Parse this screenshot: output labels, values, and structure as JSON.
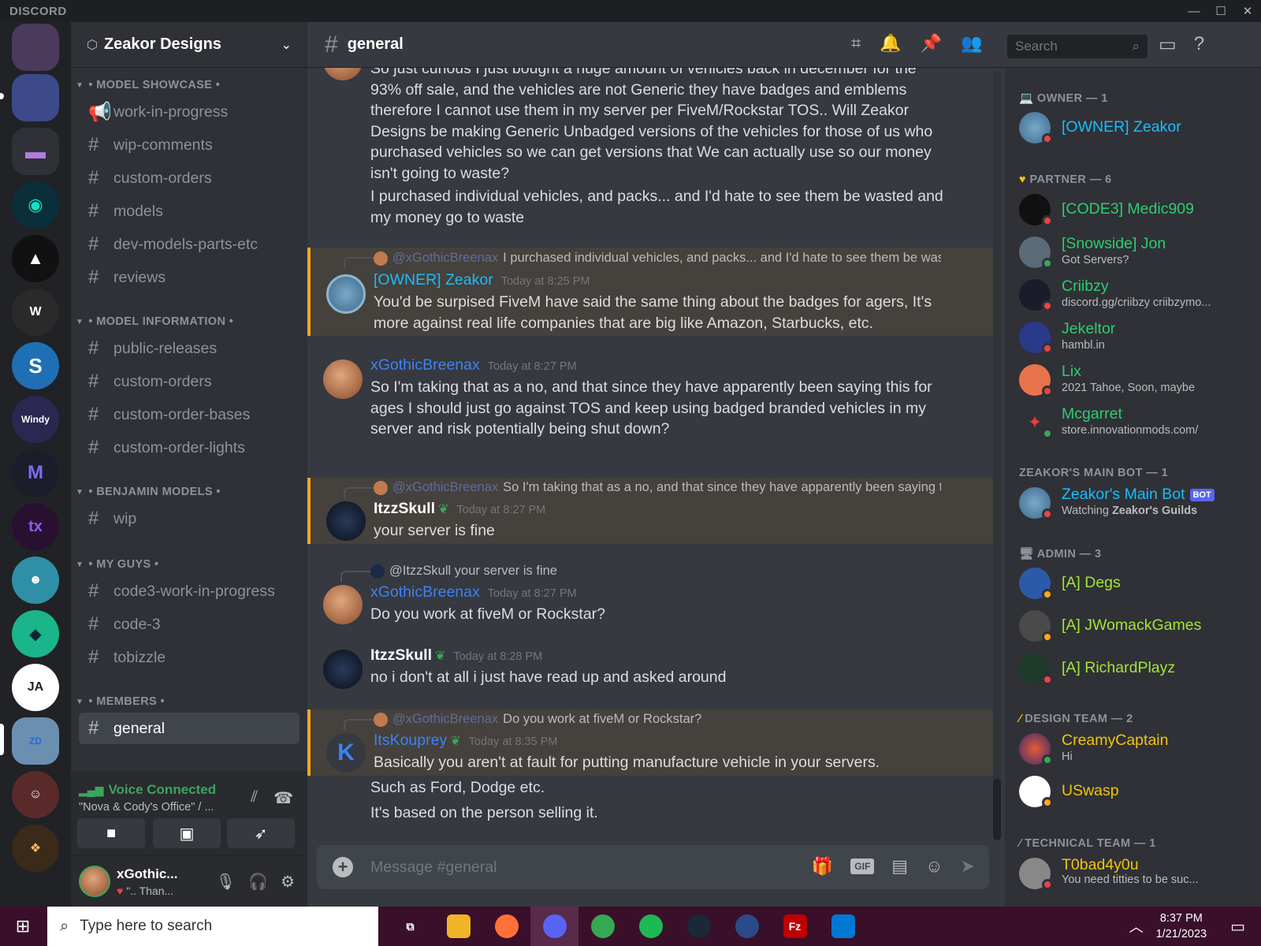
{
  "app": {
    "brand": "DISCORD"
  },
  "guild": {
    "name": "Zeakor Designs"
  },
  "categories": {
    "showcase": "• MODEL SHOWCASE •",
    "info": "• MODEL INFORMATION •",
    "benjamin": "• BENJAMIN MODELS •",
    "myguys": "• MY GUYS •",
    "members": "• MEMBERS •"
  },
  "channels": {
    "showcase": [
      "work-in-progress",
      "wip-comments",
      "custom-orders",
      "models",
      "dev-models-parts-etc",
      "reviews"
    ],
    "info": [
      "public-releases",
      "custom-orders",
      "custom-order-bases",
      "custom-order-lights"
    ],
    "benjamin": [
      "wip"
    ],
    "myguys": [
      "code3-work-in-progress",
      "code-3",
      "tobizzle"
    ],
    "members": [
      "general"
    ]
  },
  "voice": {
    "title": "Voice Connected",
    "sub": "\"Nova & Cody's Office\" / ..."
  },
  "user": {
    "name": "xGothic...",
    "status": "\".. Than..."
  },
  "header": {
    "channel": "general",
    "search_placeholder": "Search"
  },
  "messages": {
    "m1": {
      "body1": "So just curious I just bought a huge amount of vehicles back in december for the 93% off sale, and the vehicles are not Generic they have badges and emblems therefore I cannot use them in my server per FiveM/Rockstar TOS.. Will Zeakor Designs be making Generic Unbadged versions of the vehicles for those of us who purchased vehicles so we can get versions that We can actually use so our money isn't going to waste?",
      "body2": "I purchased individual vehicles, and packs... and I'd hate to see them be wasted and my money go to waste"
    },
    "m2": {
      "reply_mention": "@xGothicBreenax",
      "reply_text": "I purchased individual vehicles, and packs... and I'd hate to see them be wasted",
      "author": "[OWNER] Zeakor",
      "time": "Today at 8:25 PM",
      "body": "You'd be surpised FiveM have said the same thing about the badges for agers, It's more against real life companies that are big like Amazon, Starbucks, etc."
    },
    "m3": {
      "author": "xGothicBreenax",
      "time": "Today at 8:27 PM",
      "body": "So I'm taking that as a no, and that since they have apparently been saying this for ages I should just go against TOS and keep using badged branded vehicles in my server and risk potentially being shut down?"
    },
    "m4": {
      "reply_mention": "@xGothicBreenax",
      "reply_text": "So I'm taking that as a no, and that since they have apparently been saying this for ages",
      "author": "ItzzSkull",
      "time": "Today at 8:27 PM",
      "body": "your server is fine"
    },
    "m5": {
      "reply_text": "@ItzzSkull your server is fine",
      "author": "xGothicBreenax",
      "time": "Today at 8:27 PM",
      "body": "Do you work at fiveM or Rockstar?"
    },
    "m6": {
      "author": "ItzzSkull",
      "time": "Today at 8:28 PM",
      "body": "no i don't at all i just have read up and asked around"
    },
    "m7": {
      "reply_mention": "@xGothicBreenax",
      "reply_text": "Do you work at fiveM or Rockstar?",
      "author": "ItsKouprey",
      "time": "Today at 8:35 PM",
      "body": "Basically you aren't at fault for putting manufacture vehicle in your servers."
    },
    "m8": {
      "body": "Such as Ford, Dodge etc."
    },
    "m9": {
      "body": "It's based on the person selling it."
    }
  },
  "composer": {
    "placeholder": "Message #general",
    "gif": "GIF"
  },
  "members": {
    "owner_cat": "OWNER — 1",
    "owner": [
      {
        "name": "[OWNER] Zeakor",
        "color": "#1abcfe"
      }
    ],
    "partner_cat": "PARTNER — 6",
    "partner": [
      {
        "name": "[CODE3] Medic909",
        "activity": ""
      },
      {
        "name": "[Snowside] Jon",
        "activity": "Got Servers?"
      },
      {
        "name": "Criibzy",
        "activity": "discord.gg/criibzy criibzymo..."
      },
      {
        "name": "Jekeltor",
        "activity": "hambl.in"
      },
      {
        "name": "Lix",
        "activity": "2021 Tahoe, Soon, maybe"
      },
      {
        "name": "Mcgarret",
        "activity": "store.innovationmods.com/"
      }
    ],
    "bot_cat": "ZEAKOR'S MAIN BOT — 1",
    "bot": {
      "name": "Zeakor's Main Bot",
      "badge": "BOT",
      "activity_prefix": "Watching",
      "activity_bold": "Zeakor's Guilds"
    },
    "admin_cat": "ADMIN — 3",
    "admin": [
      "[A] Degs",
      "[A] JWomackGames",
      "[A] RichardPlayz"
    ],
    "design_cat": "DESIGN TEAM — 2",
    "design": [
      {
        "name": "CreamyCaptain",
        "activity": "Hi"
      },
      {
        "name": "USwasp",
        "activity": ""
      }
    ],
    "tech_cat": "TECHNICAL TEAM — 1",
    "tech": [
      {
        "name": "T0bad4y0u",
        "activity": "You need titties to be suc..."
      }
    ]
  },
  "taskbar": {
    "search_placeholder": "Type here to search",
    "time": "8:37 PM",
    "date": "1/21/2023"
  },
  "colors": {
    "partner": "#2ecc71",
    "admin": "#a3e635",
    "design": "#f1c40f",
    "tech": "#f1c40f",
    "owner": "#1abcfe",
    "blue_user": "#3b82f6",
    "status_dnd": "#ed4245",
    "status_online": "#3ba55d",
    "status_idle": "#faa81a"
  }
}
